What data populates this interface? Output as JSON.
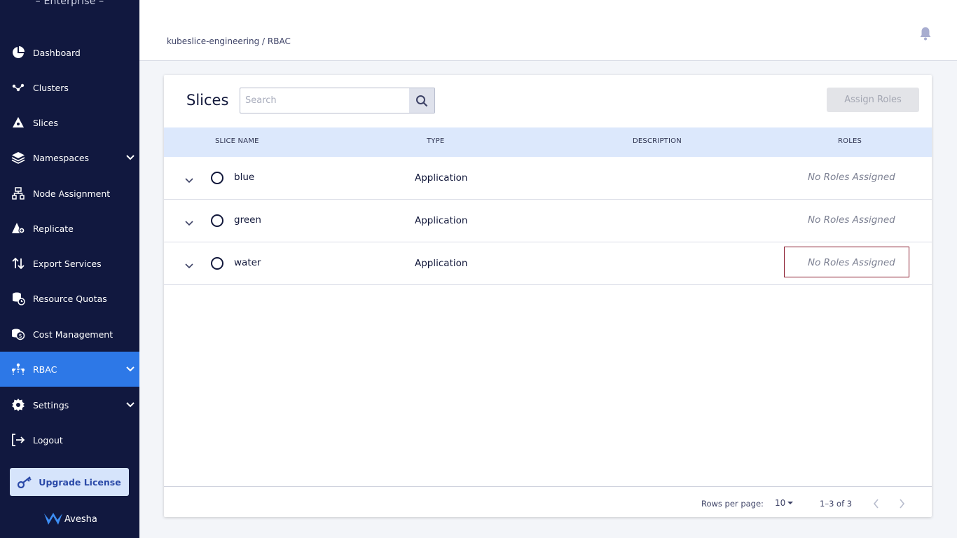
{
  "sidebar": {
    "brand": "– Enterprise –",
    "items": [
      {
        "label": "Dashboard",
        "icon": "pie-chart-icon"
      },
      {
        "label": "Clusters",
        "icon": "cluster-nodes-icon"
      },
      {
        "label": "Slices",
        "icon": "slice-icon"
      },
      {
        "label": "Namespaces",
        "icon": "layers-icon",
        "expandable": true
      },
      {
        "label": "Node Assignment",
        "icon": "node-tree-icon"
      },
      {
        "label": "Replicate",
        "icon": "replicate-icon"
      },
      {
        "label": "Export Services",
        "icon": "arrows-up-down-icon"
      },
      {
        "label": "Resource Quotas",
        "icon": "database-clock-icon"
      },
      {
        "label": "Cost Management",
        "icon": "coins-icon"
      },
      {
        "label": "RBAC",
        "icon": "users-network-icon",
        "expandable": true,
        "active": true
      },
      {
        "label": "Settings",
        "icon": "gear-icon",
        "expandable": true
      },
      {
        "label": "Logout",
        "icon": "logout-icon"
      }
    ],
    "upgrade_label": "Upgrade License",
    "logo_text": "Avesha"
  },
  "header": {
    "breadcrumb": "kubeslice-engineering / RBAC"
  },
  "main": {
    "title": "Slices",
    "search_placeholder": "Search",
    "assign_label": "Assign Roles",
    "columns": [
      "SLICE NAME",
      "TYPE",
      "DESCRIPTION",
      "ROLES"
    ],
    "rows": [
      {
        "name": "blue",
        "type": "Application",
        "description": "",
        "roles": "No Roles Assigned"
      },
      {
        "name": "green",
        "type": "Application",
        "description": "",
        "roles": "No Roles Assigned"
      },
      {
        "name": "water",
        "type": "Application",
        "description": "",
        "roles": "No Roles Assigned"
      }
    ],
    "footer": {
      "rows_per_page_label": "Rows per page:",
      "rows_per_page_value": "10",
      "range": "1–3 of 3"
    }
  },
  "colors": {
    "sidebar_bg": "#11183f",
    "active_bg": "#2d78e7",
    "header_row_bg": "#dce8fc",
    "focus_outline": "#8a1b2e"
  }
}
